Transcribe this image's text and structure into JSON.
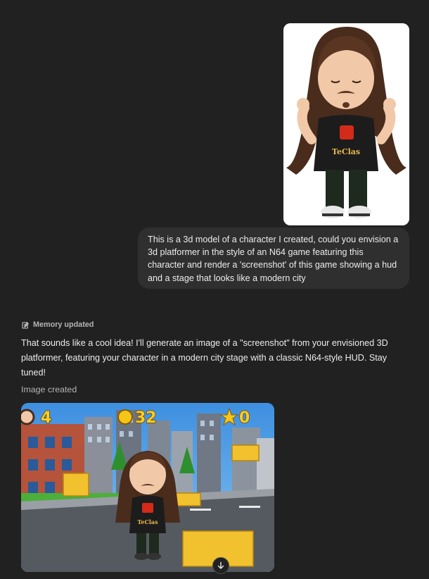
{
  "user_message": {
    "text": "This is a 3d model of a character I created, could you envision a 3d platformer in the style of an N64 game featuring this character and render a 'screenshot' of this game showing a hud and a stage that looks like a modern city",
    "image_shirt_text": "TeClas"
  },
  "assistant": {
    "memory_label": "Memory updated",
    "memory_icon": "memory-icon",
    "text": "That sounds like a cool idea! I'll generate an image of a \"screenshot\" from your envisioned 3D platformer, featuring your character in a modern city stage with a classic N64-style HUD. Stay tuned!",
    "image_caption": "Image created",
    "hud": {
      "lives": "4",
      "coins": "32",
      "stars": "0"
    },
    "generated_shirt_text": "TeClas"
  },
  "controls": {
    "scroll_icon": "arrow-down-icon"
  },
  "colors": {
    "background": "#212121",
    "bubble": "#2f2f2f",
    "text": "#ececec",
    "muted": "#b4b4b4",
    "hud_yellow": "#f5d020",
    "sky": "#4aa3e8",
    "grass": "#4caf3a"
  }
}
